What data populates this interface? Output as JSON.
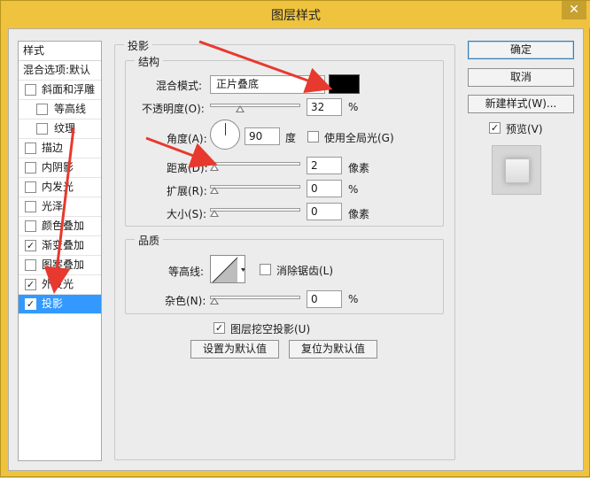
{
  "window": {
    "title": "图层样式",
    "close_label": "✕"
  },
  "left_list": {
    "header": "样式",
    "items": [
      {
        "label": "混合选项:默认",
        "checkbox": null
      },
      {
        "label": "斜面和浮雕",
        "checkbox": ""
      },
      {
        "label": "等高线",
        "checkbox": ""
      },
      {
        "label": "纹理",
        "checkbox": ""
      },
      {
        "label": "描边",
        "checkbox": ""
      },
      {
        "label": "内阴影",
        "checkbox": ""
      },
      {
        "label": "内发光",
        "checkbox": ""
      },
      {
        "label": "光泽",
        "checkbox": ""
      },
      {
        "label": "颜色叠加",
        "checkbox": ""
      },
      {
        "label": "渐变叠加",
        "checkbox": "✓"
      },
      {
        "label": "图案叠加",
        "checkbox": ""
      },
      {
        "label": "外发光",
        "checkbox": "✓"
      },
      {
        "label": "投影",
        "checkbox": "✓"
      }
    ]
  },
  "main": {
    "section_title": "投影",
    "structure": {
      "title": "结构",
      "blend_mode_label": "混合模式:",
      "blend_mode_value": "正片叠底",
      "shadow_color": "#000000",
      "opacity_label": "不透明度(O):",
      "opacity_value": "32",
      "opacity_unit": "%",
      "angle_label": "角度(A):",
      "angle_value": "90",
      "angle_unit": "度",
      "global_light_label": "使用全局光(G)",
      "distance_label": "距离(D):",
      "distance_value": "2",
      "distance_unit": "像素",
      "spread_label": "扩展(R):",
      "spread_value": "0",
      "spread_unit": "%",
      "size_label": "大小(S):",
      "size_value": "0",
      "size_unit": "像素"
    },
    "quality": {
      "title": "品质",
      "contour_label": "等高线:",
      "anti_alias_label": "消除锯齿(L)",
      "noise_label": "杂色(N):",
      "noise_value": "0",
      "noise_unit": "%"
    },
    "knockout_label": "图层挖空投影(U)",
    "set_default_label": "设置为默认值",
    "reset_default_label": "复位为默认值"
  },
  "right": {
    "ok_label": "确定",
    "cancel_label": "取消",
    "new_style_label": "新建样式(W)...",
    "preview_label": "预览(V)",
    "preview_checked": "✓"
  },
  "colors": {
    "titlebar": "#efc33e",
    "selection": "#3399ff",
    "annotation_arrow": "#e8392f"
  }
}
